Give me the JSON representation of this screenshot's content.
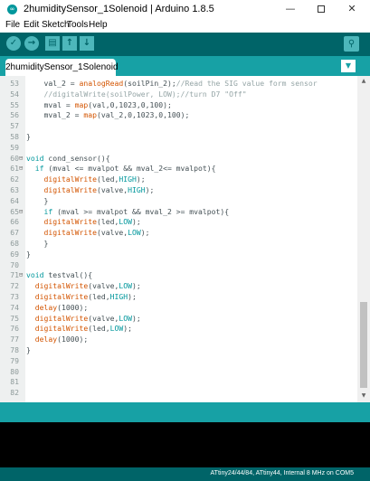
{
  "window": {
    "title": "2humiditySensor_1Solenoid | Arduino 1.8.5",
    "app_icon": "arduino-icon",
    "controls": {
      "minimize": "—",
      "close": "✕"
    }
  },
  "menu": [
    "File",
    "Edit",
    "Sketch",
    "Tools",
    "Help"
  ],
  "toolbar": {
    "buttons": [
      {
        "name": "verify-button",
        "icon": "check-icon",
        "glyph": "✓"
      },
      {
        "name": "upload-button",
        "icon": "arrow-right-icon",
        "glyph": "→"
      },
      {
        "name": "new-button",
        "icon": "new-file-icon",
        "glyph": "▤"
      },
      {
        "name": "open-button",
        "icon": "arrow-up-icon",
        "glyph": "↑"
      },
      {
        "name": "save-button",
        "icon": "arrow-down-icon",
        "glyph": "↓"
      }
    ],
    "serial_monitor_glyph": "⚲",
    "accent": "#006468",
    "button_color": "#4db7bb"
  },
  "tabs": [
    {
      "label": "2humiditySensor_1Solenoid"
    }
  ],
  "tab_menu_glyph": "▼",
  "editor": {
    "lines": [
      {
        "n": "53",
        "fold": "",
        "code": "    val_2 = analogRead(soilPin_2);//Read the SIG value form sensor"
      },
      {
        "n": "54",
        "fold": "",
        "code": "    //digitalWrite(soilPower, LOW);//turn D7 \"Off\""
      },
      {
        "n": "55",
        "fold": "",
        "code": "    mval = map(val,0,1023,0,100);"
      },
      {
        "n": "56",
        "fold": "",
        "code": "    mval_2 = map(val_2,0,1023,0,100);"
      },
      {
        "n": "57",
        "fold": "",
        "code": ""
      },
      {
        "n": "58",
        "fold": "",
        "code": "}"
      },
      {
        "n": "59",
        "fold": "",
        "code": ""
      },
      {
        "n": "60",
        "fold": "⊟",
        "code": "void cond_sensor(){"
      },
      {
        "n": "61",
        "fold": "⊟",
        "code": "  if (mval <= mvalpot && mval_2<= mvalpot){"
      },
      {
        "n": "62",
        "fold": "",
        "code": "    digitalWrite(led,HIGH);"
      },
      {
        "n": "63",
        "fold": "",
        "code": "    digitalWrite(valve,HIGH);"
      },
      {
        "n": "64",
        "fold": "",
        "code": "    }"
      },
      {
        "n": "65",
        "fold": "⊟",
        "code": "    if (mval >= mvalpot && mval_2 >= mvalpot){"
      },
      {
        "n": "66",
        "fold": "",
        "code": "    digitalWrite(led,LOW);"
      },
      {
        "n": "67",
        "fold": "",
        "code": "    digitalWrite(valve,LOW);"
      },
      {
        "n": "68",
        "fold": "",
        "code": "    }"
      },
      {
        "n": "69",
        "fold": "",
        "code": "}"
      },
      {
        "n": "70",
        "fold": "",
        "code": ""
      },
      {
        "n": "71",
        "fold": "⊟",
        "code": "void testval(){"
      },
      {
        "n": "72",
        "fold": "",
        "code": "  digitalWrite(valve,LOW);"
      },
      {
        "n": "73",
        "fold": "",
        "code": "  digitalWrite(led,HIGH);"
      },
      {
        "n": "74",
        "fold": "",
        "code": "  delay(1000);"
      },
      {
        "n": "75",
        "fold": "",
        "code": "  digitalWrite(valve,LOW);"
      },
      {
        "n": "76",
        "fold": "",
        "code": "  digitalWrite(led,LOW);"
      },
      {
        "n": "77",
        "fold": "",
        "code": "  delay(1000);"
      },
      {
        "n": "78",
        "fold": "",
        "code": "}"
      },
      {
        "n": "79",
        "fold": "",
        "code": ""
      },
      {
        "n": "80",
        "fold": "",
        "code": ""
      },
      {
        "n": "81",
        "fold": "",
        "code": ""
      },
      {
        "n": "82",
        "fold": "",
        "code": ""
      }
    ],
    "colors": {
      "function": "#d35400",
      "keyword": "#00979c",
      "comment": "#95a5a6",
      "text": "#434f54"
    },
    "scrollbar": {
      "up_glyph": "▲",
      "down_glyph": "▼"
    }
  },
  "status": {
    "board": "ATtiny24/44/84, ATtiny44, Internal 8 MHz on COM5"
  }
}
